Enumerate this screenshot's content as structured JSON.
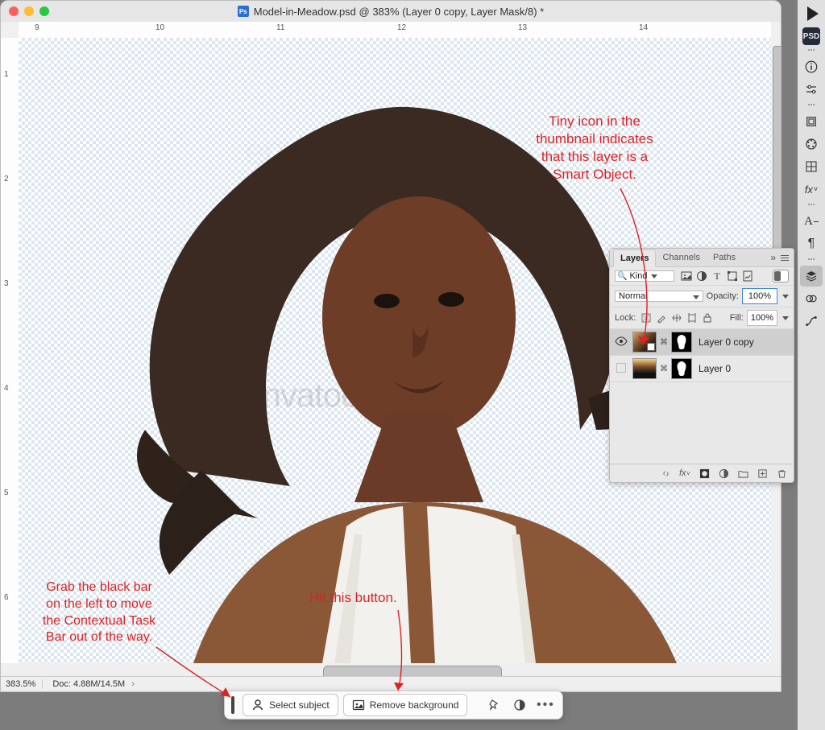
{
  "titlebar": {
    "title": "Model-in-Meadow.psd @ 383% (Layer 0 copy, Layer Mask/8) *"
  },
  "ruler_h": {
    "ticks": [
      "9",
      "10",
      "11",
      "12",
      "13",
      "14"
    ]
  },
  "ruler_v": {
    "ticks": [
      "1",
      "2",
      "3",
      "4",
      "5",
      "6"
    ]
  },
  "status": {
    "zoom": "383.5%",
    "doc": "Doc: 4.88M/14.5M"
  },
  "layers_panel": {
    "tabs": [
      "Layers",
      "Channels",
      "Paths"
    ],
    "active_tab": 0,
    "kind_label": "Kind",
    "kind_search_glyph": "🔍",
    "blend_mode": "Normal",
    "opacity_label": "Opacity:",
    "opacity_value": "100%",
    "lock_label": "Lock:",
    "fill_label": "Fill:",
    "fill_value": "100%",
    "layers": [
      {
        "name": "Layer 0 copy",
        "visible": true,
        "smart": true,
        "mask": true,
        "active": true
      },
      {
        "name": "Layer 0",
        "visible": false,
        "smart": false,
        "mask": true,
        "active": false
      }
    ]
  },
  "contextual_bar": {
    "select_subject": "Select subject",
    "remove_background": "Remove background"
  },
  "annotations": {
    "top_right": "Tiny icon in the\nthumbnail indicates\nthat this layer is a\nSmart Object.",
    "middle": "Hit this button.",
    "bottom_left": "Grab the black bar\non the left to move\nthe Contextual Task\nBar out of the way."
  },
  "watermark": "envatoelements"
}
